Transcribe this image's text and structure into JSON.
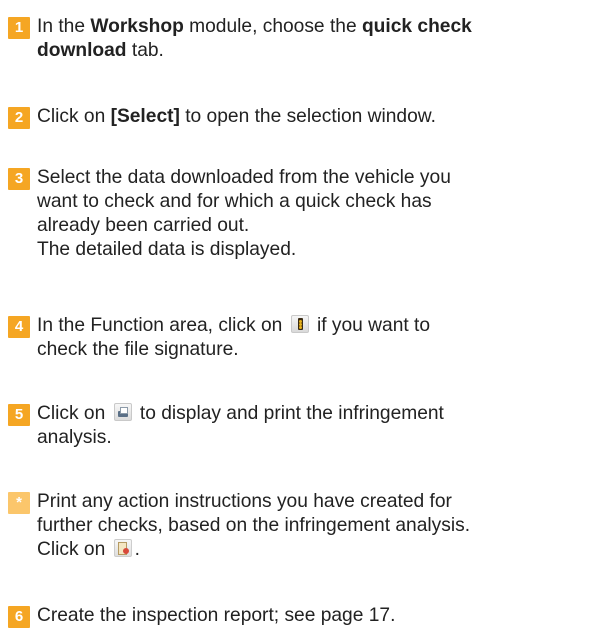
{
  "colors": {
    "badge": "#f5a623",
    "badge_star": "#fbc66b",
    "text": "#222222"
  },
  "steps": [
    {
      "badge": "1",
      "lines": [
        {
          "t1": "In the ",
          "b1": "Workshop",
          "t2": " module, choose the ",
          "b2": "quick check"
        },
        {
          "b1": "download",
          "t2": " tab."
        }
      ]
    },
    {
      "badge": "2",
      "lines": [
        {
          "t1": "Click on ",
          "b1": "[Select]",
          "t2": " to open the selection window."
        }
      ]
    },
    {
      "badge": "3",
      "lines": [
        {
          "t1": "Select the data downloaded from the vehicle you"
        },
        {
          "t1": "want to check and for which a quick check has"
        },
        {
          "t1": "already been carried out."
        },
        {
          "t1": "The detailed data is displayed."
        }
      ]
    },
    {
      "badge": "4",
      "icon": "traffic-light-signature-icon",
      "lines": [
        {
          "t1": "In the Function area, click on ",
          "t2": " if you want to"
        },
        {
          "t1": "check the file signature."
        }
      ]
    },
    {
      "badge": "5",
      "icon": "printer-icon",
      "lines": [
        {
          "t1": "Click on ",
          "t2": " to display and print the infringement"
        },
        {
          "t1": "analysis."
        }
      ]
    },
    {
      "badge": "*",
      "icon": "action-instructions-icon",
      "lines": [
        {
          "t1": "Print any action instructions you have created for"
        },
        {
          "t1": "further checks, based on the infringement analysis."
        },
        {
          "t1": "Click on ",
          "t2": "."
        }
      ]
    },
    {
      "badge": "6",
      "lines": [
        {
          "t1": "Create the inspection report; see page 17."
        }
      ]
    }
  ]
}
